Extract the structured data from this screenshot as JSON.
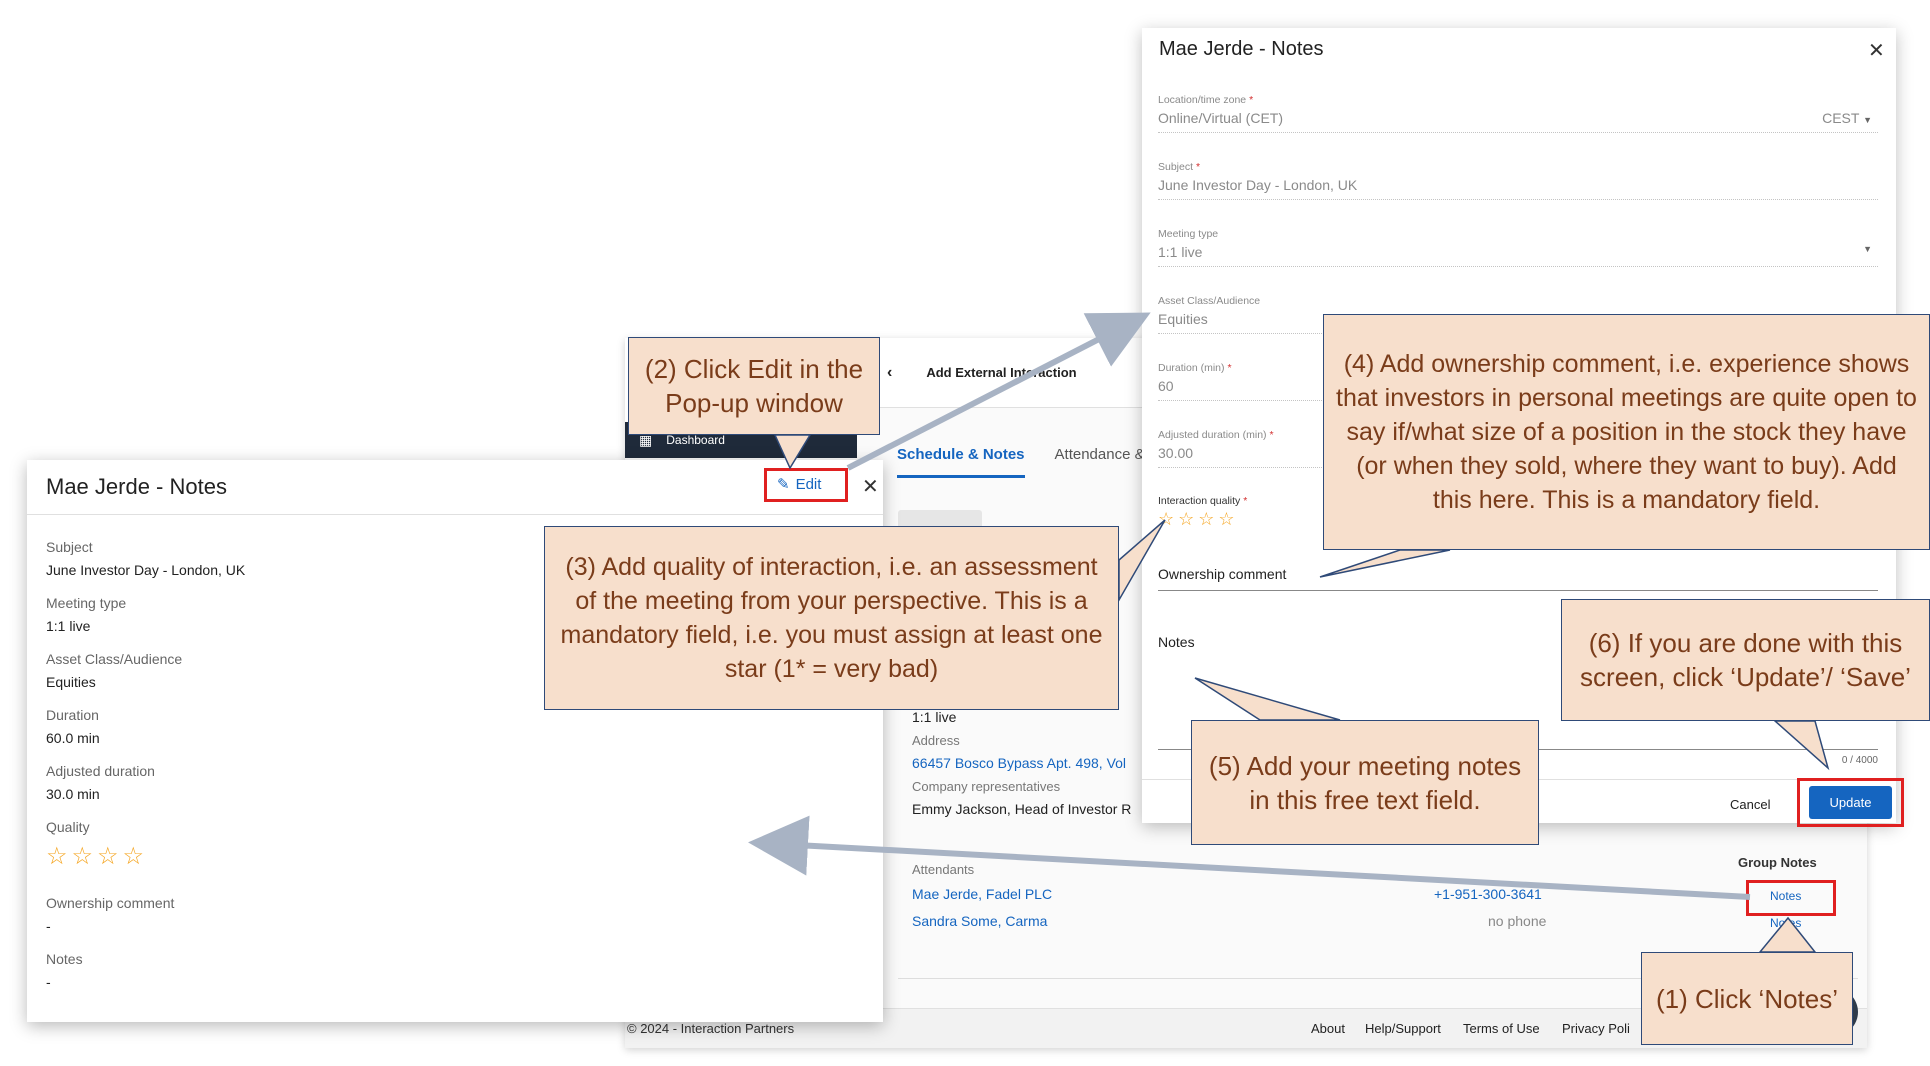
{
  "background_app": {
    "sidebar_item": "Dashboard",
    "header_title": "Add External Interaction",
    "tabs": [
      "Schedule & Notes",
      "Attendance &"
    ],
    "meeting_type_value": "1:1 live",
    "address_label": "Address",
    "address_value": "66457 Bosco Bypass Apt. 498, Vol",
    "company_reps_label": "Company representatives",
    "company_reps_value": "Emmy Jackson, Head of Investor R",
    "attendants_label": "Attendants",
    "group_notes_label": "Group Notes",
    "attendants": [
      {
        "name": "Mae Jerde, Fadel PLC",
        "phone": "+1-951-300-3641",
        "notes": "Notes"
      },
      {
        "name": "Sandra Some, Carma",
        "phone": "no phone",
        "notes": "Notes"
      }
    ],
    "footer": {
      "copyright": "© 2024 - Interaction Partners",
      "links": [
        "About",
        "Help/Support",
        "Terms of Use",
        "Privacy Poli"
      ]
    }
  },
  "modal_edit": {
    "title": "Mae Jerde - Notes",
    "fields": {
      "location": {
        "label": "Location/time zone",
        "value": "Online/Virtual (CET)",
        "tz": "CEST"
      },
      "subject": {
        "label": "Subject",
        "value": "June Investor Day - London, UK"
      },
      "meeting_type": {
        "label": "Meeting type",
        "value": "1:1 live"
      },
      "asset_class": {
        "label": "Asset Class/Audience",
        "value": "Equities"
      },
      "duration": {
        "label": "Duration (min)",
        "value": "60"
      },
      "adjusted_duration": {
        "label": "Adjusted duration (min)",
        "value": "30.00"
      },
      "interaction_quality": {
        "label": "Interaction quality",
        "stars": 4,
        "selected": 0
      },
      "ownership_comment": {
        "label": "Ownership comment"
      },
      "notes": {
        "label": "Notes",
        "counter": "0 / 4000"
      }
    },
    "cancel_label": "Cancel",
    "update_label": "Update"
  },
  "modal_view": {
    "title": "Mae Jerde - Notes",
    "edit_label": "Edit",
    "fields": [
      {
        "label": "Subject",
        "value": "June Investor Day - London, UK"
      },
      {
        "label": "Meeting type",
        "value": "1:1 live"
      },
      {
        "label": "Asset Class/Audience",
        "value": "Equities"
      },
      {
        "label": "Duration",
        "value": "60.0 min"
      },
      {
        "label": "Adjusted duration",
        "value": "30.0 min"
      }
    ],
    "quality_label": "Quality",
    "quality_stars": 4,
    "ownership_label": "Ownership comment",
    "ownership_value": "-",
    "notes_label": "Notes",
    "notes_value": "-"
  },
  "callouts": {
    "c1": "(1) Click ‘Notes’",
    "c2": "(2) Click Edit in the Pop-up window",
    "c3": "(3) Add quality of interaction, i.e. an assessment of the meeting from your perspective. This is a mandatory field, i.e. you must assign at least one star (1* = very bad)",
    "c4": "(4) Add ownership comment, i.e. experience shows that investors in personal meetings are quite open to say if/what size of a position in the stock they have (or when they sold, where they want to buy). Add this here. This is a mandatory field.",
    "c5": "(5) Add your meeting notes in this free text field.",
    "c6": "(6) If you are done with this screen, click ‘Update’/ ‘Save’"
  },
  "colors": {
    "callout_bg": "#f7dfcc",
    "callout_text": "#7a3c1a",
    "highlight_red": "#e02020",
    "primary_blue": "#1565c0",
    "star": "#f5a623"
  }
}
